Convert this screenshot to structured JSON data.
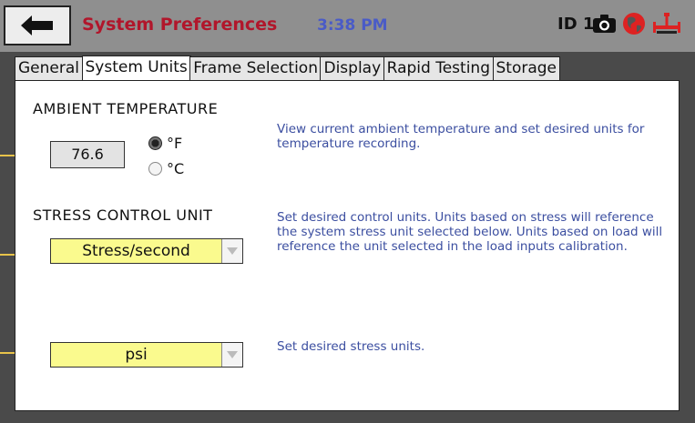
{
  "header": {
    "title": "System Preferences",
    "time": "3:38 PM",
    "device_id": "ID 1",
    "icons": [
      "back-arrow-icon",
      "camera-icon",
      "globe-icon",
      "hydrant-icon"
    ],
    "colors": {
      "title": "#b1162b",
      "time": "#4a5bc7",
      "bar": "#8f8f8f"
    }
  },
  "tabs": [
    {
      "label": "General",
      "active": false
    },
    {
      "label": "System Units",
      "active": true
    },
    {
      "label": "Frame Selection",
      "active": false
    },
    {
      "label": "Display",
      "active": false
    },
    {
      "label": "Rapid Testing",
      "active": false
    },
    {
      "label": "Storage",
      "active": false
    }
  ],
  "ambient": {
    "label": "AMBIENT TEMPERATURE",
    "value": "76.6",
    "unit_f": "°F",
    "unit_c": "°C",
    "selected_unit": "°F",
    "description": "View current ambient temperature and set desired units for temperature recording."
  },
  "stress_control": {
    "label": "STRESS CONTROL UNIT",
    "selected": "Stress/second",
    "description": "Set desired control units. Units based on stress will reference the system stress unit selected below. Units based on load will reference the unit selected in the load inputs calibration."
  },
  "stress_units": {
    "selected": "psi",
    "description": "Set desired stress units."
  }
}
